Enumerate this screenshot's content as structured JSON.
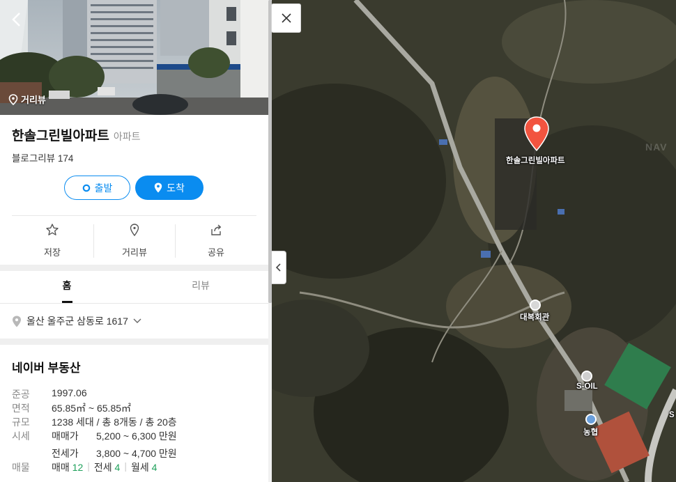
{
  "photo": {
    "roadview_label": "거리뷰"
  },
  "place": {
    "name": "한솔그린빌아파트",
    "category": "아파트",
    "review_label": "블로그리뷰",
    "review_count": "174"
  },
  "route": {
    "start_label": "출발",
    "arrive_label": "도착"
  },
  "actions": {
    "save": "저장",
    "roadview": "거리뷰",
    "share": "공유"
  },
  "tabs": {
    "home": "홈",
    "review": "리뷰"
  },
  "address": "울산 울주군 삼동로 1617",
  "realestate": {
    "title": "네이버 부동산",
    "completion_key": "준공",
    "completion_val": "1997.06",
    "area_key": "면적",
    "area_val": "65.85㎡ ~ 65.85㎡",
    "scale_key": "규모",
    "scale_val": "1238 세대 / 총 8개동 / 총 20층",
    "price_key": "시세",
    "sale_key": "매매가",
    "sale_val": "5,200 ~ 6,300 만원",
    "jeonse_key": "전세가",
    "jeonse_val": "3,800 ~ 4,700 만원",
    "listings_key": "매물",
    "listing_sale_label": "매매",
    "listing_sale_count": "12",
    "listing_jeonse_label": "전세",
    "listing_jeonse_count": "4",
    "listing_monthly_label": "월세",
    "listing_monthly_count": "4"
  },
  "map": {
    "pin_label": "한솔그린빌아파트",
    "poi_hall": "대복회관",
    "poi_gas": "S-OIL",
    "poi_bank": "농협",
    "watermark": "NAV",
    "edge_label": "S"
  },
  "colors": {
    "accent": "#0a8cf0",
    "pin": "#f2543f",
    "count_green": "#1fa15b"
  },
  "icons": {
    "back": "chevron-left-icon",
    "roadview": "location-pin-outline-icon",
    "start": "circle-dot-icon",
    "arrive": "location-pin-icon",
    "save": "star-outline-icon",
    "roadview_action": "pin-outline-icon",
    "share": "share-arrow-icon",
    "address": "location-pin-icon",
    "address_toggle": "chevron-down-icon",
    "close": "close-icon",
    "collapse": "chevron-left-icon"
  }
}
